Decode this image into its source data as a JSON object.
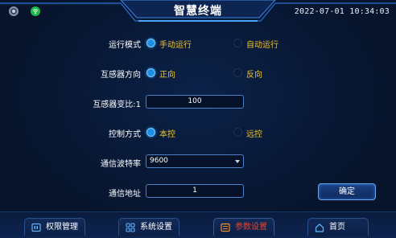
{
  "header": {
    "title": "智慧终端",
    "datetime": "2022-07-01 10:34:03",
    "status_icons": [
      "record-icon",
      "wifi-icon"
    ]
  },
  "form": {
    "run_mode": {
      "label": "运行模式",
      "options": [
        "手动运行",
        "自动运行"
      ],
      "selected": "手动运行"
    },
    "transformer_direction": {
      "label": "互感器方向",
      "options": [
        "正向",
        "反向"
      ],
      "selected": "正向"
    },
    "transformer_ratio": {
      "label": "互感器变比:1",
      "value": "100"
    },
    "control_mode": {
      "label": "控制方式",
      "options": [
        "本控",
        "远控"
      ],
      "selected": "本控"
    },
    "baud_rate": {
      "label": "通信波特率",
      "value": "9600"
    },
    "comm_address": {
      "label": "通信地址",
      "value": "1"
    },
    "confirm_label": "确定"
  },
  "nav": {
    "items": [
      {
        "label": "权限管理",
        "icon": "permissions-icon"
      },
      {
        "label": "系统设置",
        "icon": "grid-icon"
      },
      {
        "label": "参数设置",
        "icon": "parameters-icon",
        "active": true
      },
      {
        "label": "首页",
        "icon": "home-icon"
      }
    ]
  },
  "colors": {
    "background": "#07142c",
    "accent": "#1e8fe0",
    "option_text": "#f0c330",
    "active_nav": "#e4432a"
  }
}
